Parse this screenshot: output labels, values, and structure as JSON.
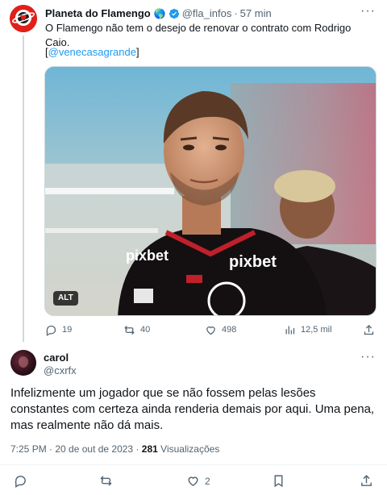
{
  "tweet": {
    "author_name": "Planeta do Flamengo",
    "author_badge_emoji": "🌎",
    "author_handle": "@fla_infos",
    "separator": "·",
    "time_ago": "57 min",
    "text": "O Flamengo não tem o desejo de renovar o contrato com Rodrigo Caio.",
    "link_open": "[",
    "link_text": "@venecasagrande",
    "link_close": "]",
    "media_alt_label": "ALT",
    "stats": {
      "replies": "19",
      "retweets": "40",
      "likes": "498",
      "views": "12,5 mil"
    }
  },
  "reply": {
    "author_name": "carol",
    "author_handle": "@cxrfx",
    "text": "Infelizmente um jogador que se não fossem pelas lesões constantes com certeza ainda renderia demais por aqui. Uma pena, mas realmente não dá mais.",
    "timestamp": "7:25 PM · 20 de out de 2023 ·",
    "views_count": "281",
    "views_label": "Visualizações",
    "likes": "2"
  },
  "colors": {
    "accent": "#1d9bf0",
    "muted": "#536471",
    "flamengo_red": "#e0201b"
  }
}
